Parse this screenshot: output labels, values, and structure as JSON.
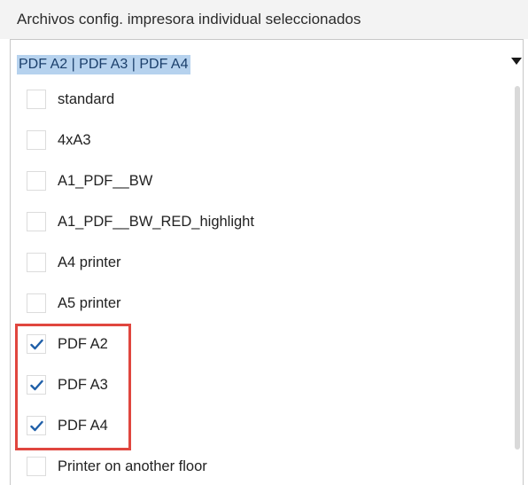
{
  "panel": {
    "title": "Archivos config. impresora individual seleccionados"
  },
  "dropdown": {
    "selected_value": "PDF A2 | PDF A3 | PDF A4",
    "options": [
      {
        "label": "standard",
        "checked": false
      },
      {
        "label": "4xA3",
        "checked": false
      },
      {
        "label": "A1_PDF__BW",
        "checked": false
      },
      {
        "label": "A1_PDF__BW_RED_highlight",
        "checked": false
      },
      {
        "label": "A4 printer",
        "checked": false
      },
      {
        "label": "A5 printer",
        "checked": false
      },
      {
        "label": "PDF A2",
        "checked": true
      },
      {
        "label": "PDF A3",
        "checked": true
      },
      {
        "label": "PDF A4",
        "checked": true
      },
      {
        "label": "Printer on another floor",
        "checked": false
      }
    ]
  },
  "colors": {
    "selected_highlight": "#b6d2ee",
    "checkmark": "#1f5fa8",
    "annotation_border": "#e0463f"
  },
  "icons": {
    "dropdown_arrow": "chevron-down-icon",
    "check": "checkmark-icon"
  }
}
